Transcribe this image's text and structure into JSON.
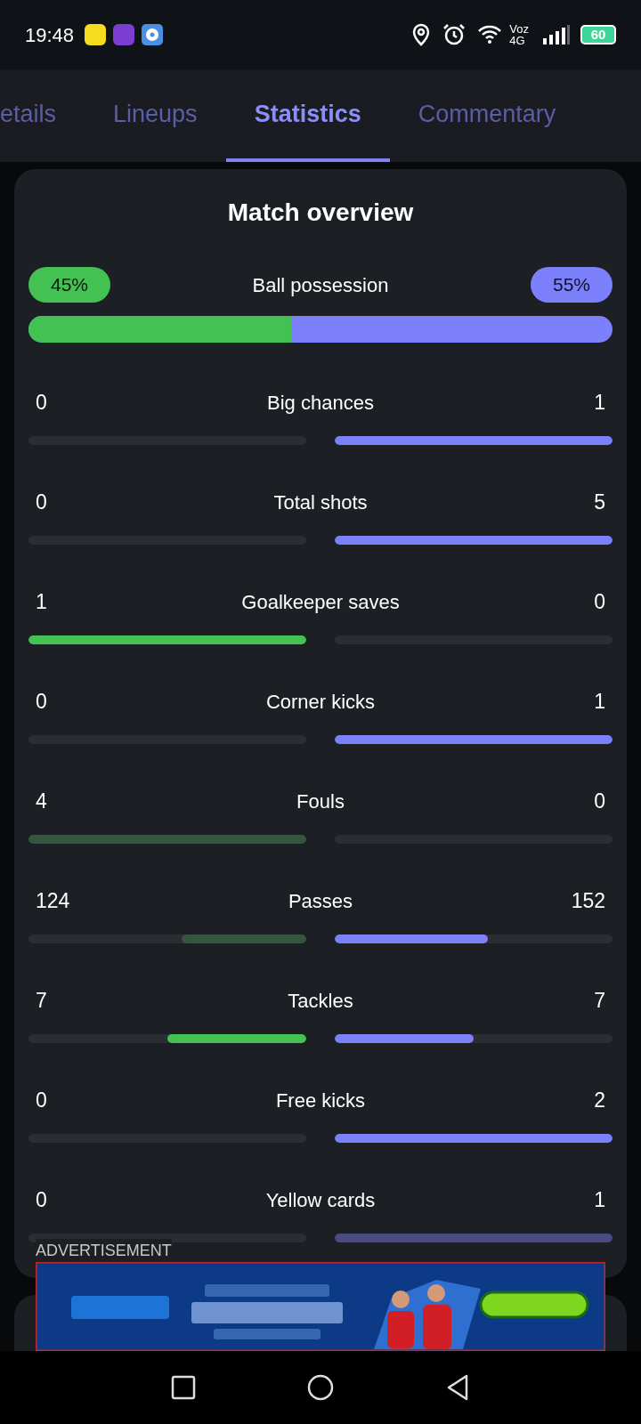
{
  "status_bar": {
    "time": "19:48",
    "network_top": "Voz",
    "network_bottom": "4G",
    "battery": "60"
  },
  "tabs": [
    {
      "label": "etails",
      "selected": false
    },
    {
      "label": "Lineups",
      "selected": false
    },
    {
      "label": "Statistics",
      "selected": true
    },
    {
      "label": "Commentary",
      "selected": false
    }
  ],
  "overview": {
    "title": "Match overview",
    "possession": {
      "label": "Ball possession",
      "home": "45%",
      "away": "55%",
      "level": 0.45
    },
    "stats": [
      {
        "label": "Big chances",
        "home": {
          "value": "0"
        },
        "away": {
          "value": "1",
          "level": 1,
          "highlighted": true
        }
      },
      {
        "label": "Total shots",
        "home": {
          "value": "0"
        },
        "away": {
          "value": "5",
          "level": 1,
          "highlighted": true
        }
      },
      {
        "label": "Goalkeeper saves",
        "home": {
          "value": "1",
          "level": 1,
          "highlighted": true
        },
        "away": {
          "value": "0"
        }
      },
      {
        "label": "Corner kicks",
        "home": {
          "value": "0"
        },
        "away": {
          "value": "1",
          "level": 1,
          "highlighted": true
        }
      },
      {
        "label": "Fouls",
        "home": {
          "value": "4",
          "level": 1,
          "highlighted": false
        },
        "away": {
          "value": "0"
        }
      },
      {
        "label": "Passes",
        "home": {
          "value": "124",
          "level": 0.45,
          "highlighted": false
        },
        "away": {
          "value": "152",
          "level": 0.55,
          "highlighted": true
        }
      },
      {
        "label": "Tackles",
        "home": {
          "value": "7",
          "level": 0.5,
          "highlighted": true
        },
        "away": {
          "value": "7",
          "level": 0.5,
          "highlighted": true
        }
      },
      {
        "label": "Free kicks",
        "home": {
          "value": "0"
        },
        "away": {
          "value": "2",
          "level": 1,
          "highlighted": true
        }
      },
      {
        "label": "Yellow cards",
        "home": {
          "value": "0"
        },
        "away": {
          "value": "1",
          "level": 1,
          "highlighted": false
        }
      }
    ]
  },
  "advertisement": {
    "label": "ADVERTISEMENT"
  }
}
